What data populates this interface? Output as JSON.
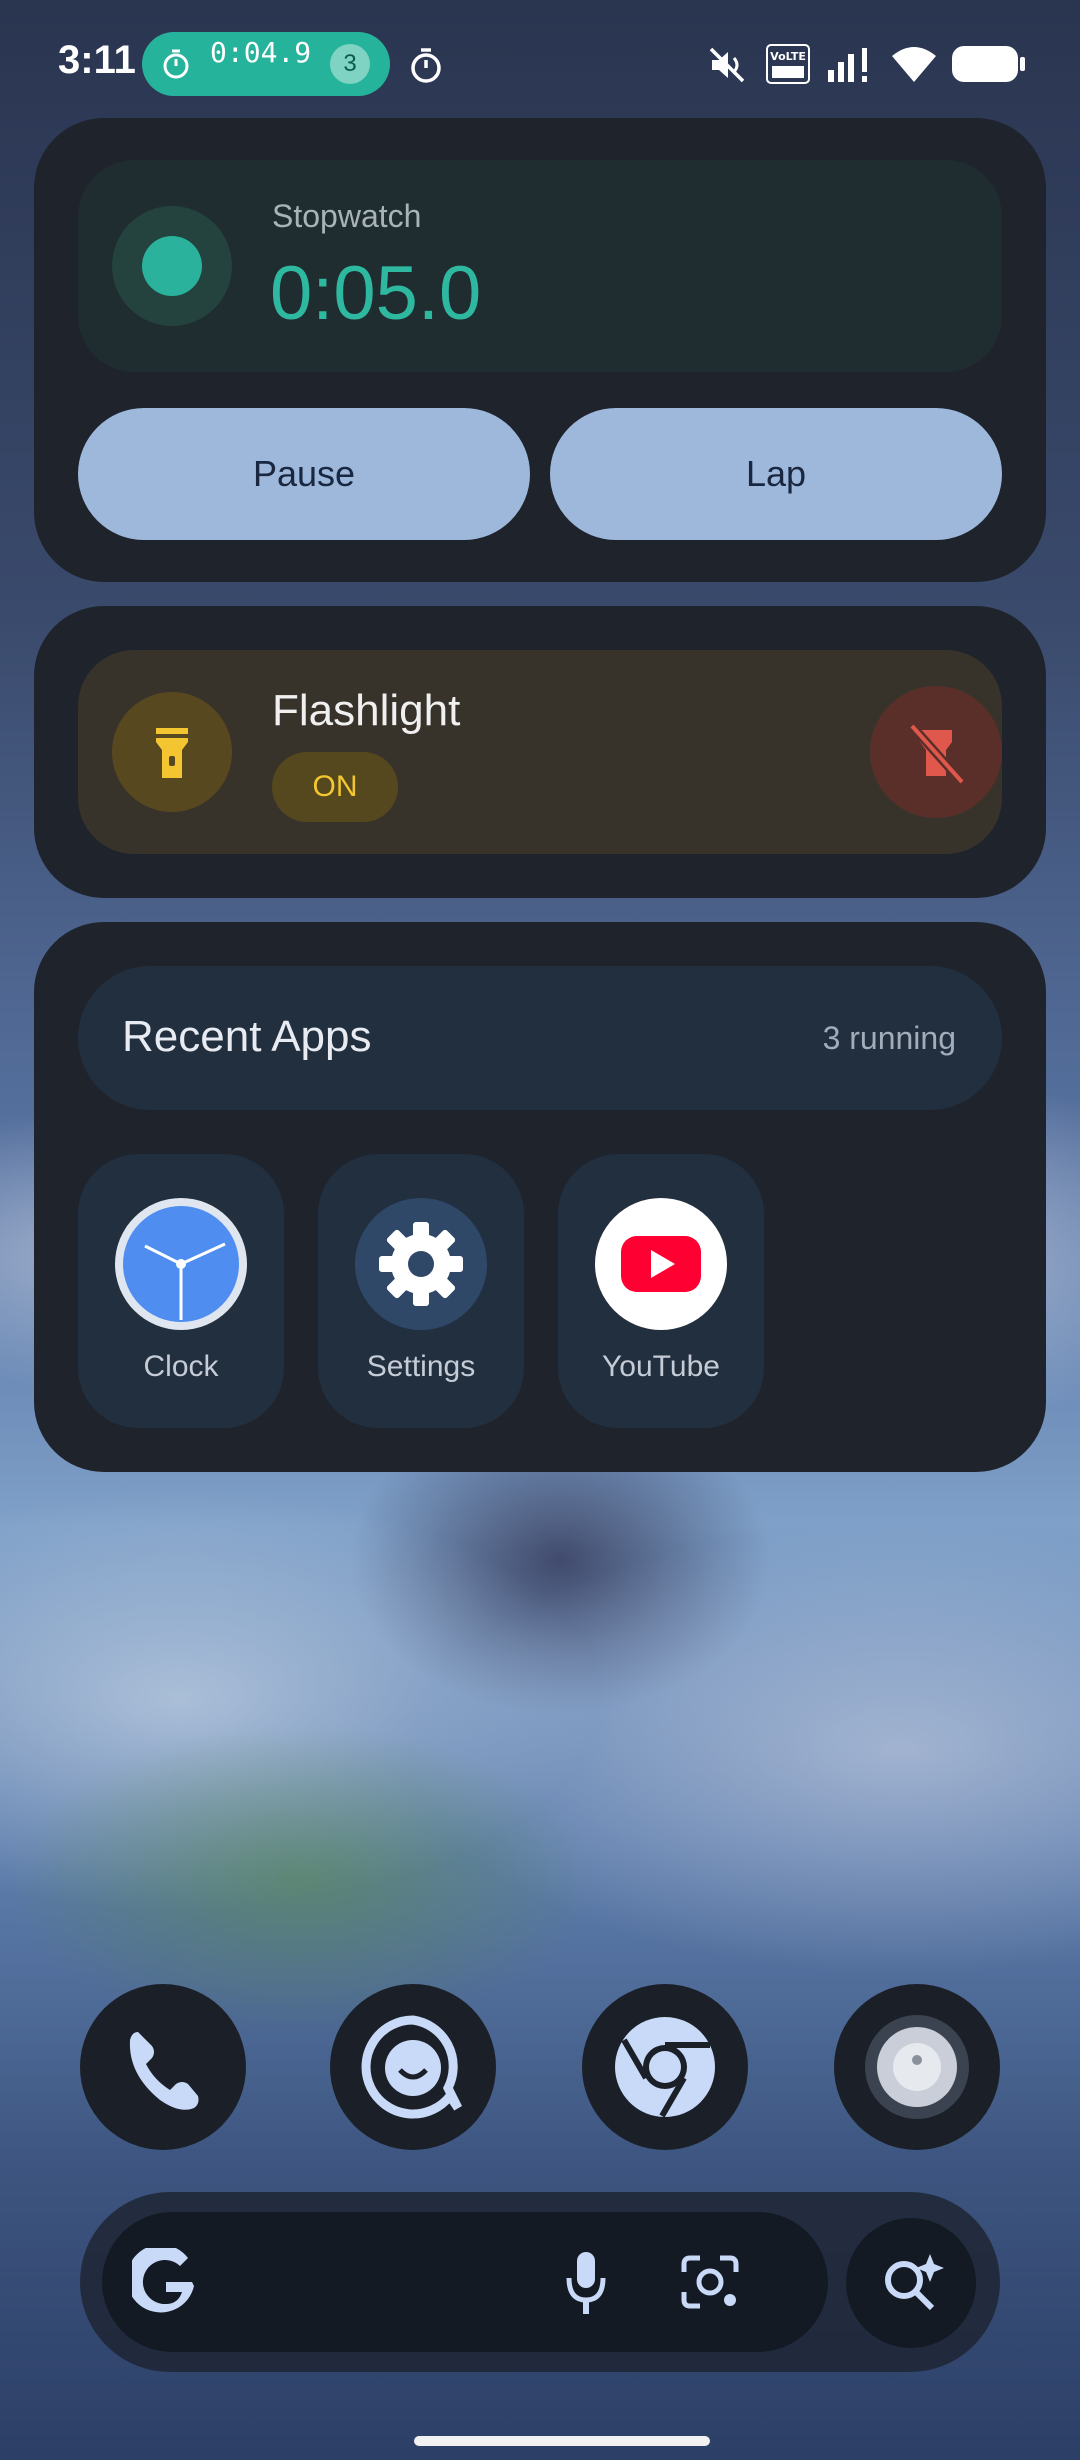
{
  "status_bar": {
    "time": "3:11",
    "chip_timer": "0:04.9",
    "chip_badge": "3",
    "icons": [
      "stopwatch-icon",
      "timer-icon",
      "mute-icon",
      "volte-icon",
      "signal-icon",
      "wifi-icon",
      "battery-icon"
    ],
    "volte_text": "VoLTE"
  },
  "stopwatch": {
    "label": "Stopwatch",
    "time": "0:05.0",
    "pause_label": "Pause",
    "lap_label": "Lap",
    "accent": "#2eb8a0"
  },
  "flashlight": {
    "title": "Flashlight",
    "state": "ON",
    "accent": "#f3c631"
  },
  "recent_apps": {
    "title": "Recent Apps",
    "count": "3 running",
    "apps": [
      {
        "label": "Clock",
        "icon": "clock-icon"
      },
      {
        "label": "Settings",
        "icon": "gear-icon"
      },
      {
        "label": "YouTube",
        "icon": "youtube-icon"
      }
    ]
  },
  "dock": {
    "icons": [
      "phone-icon",
      "messages-icon",
      "chrome-icon",
      "camera-icon"
    ]
  },
  "search": {
    "icons": [
      "google-icon",
      "mic-icon",
      "lens-icon",
      "ai-search-icon"
    ]
  }
}
